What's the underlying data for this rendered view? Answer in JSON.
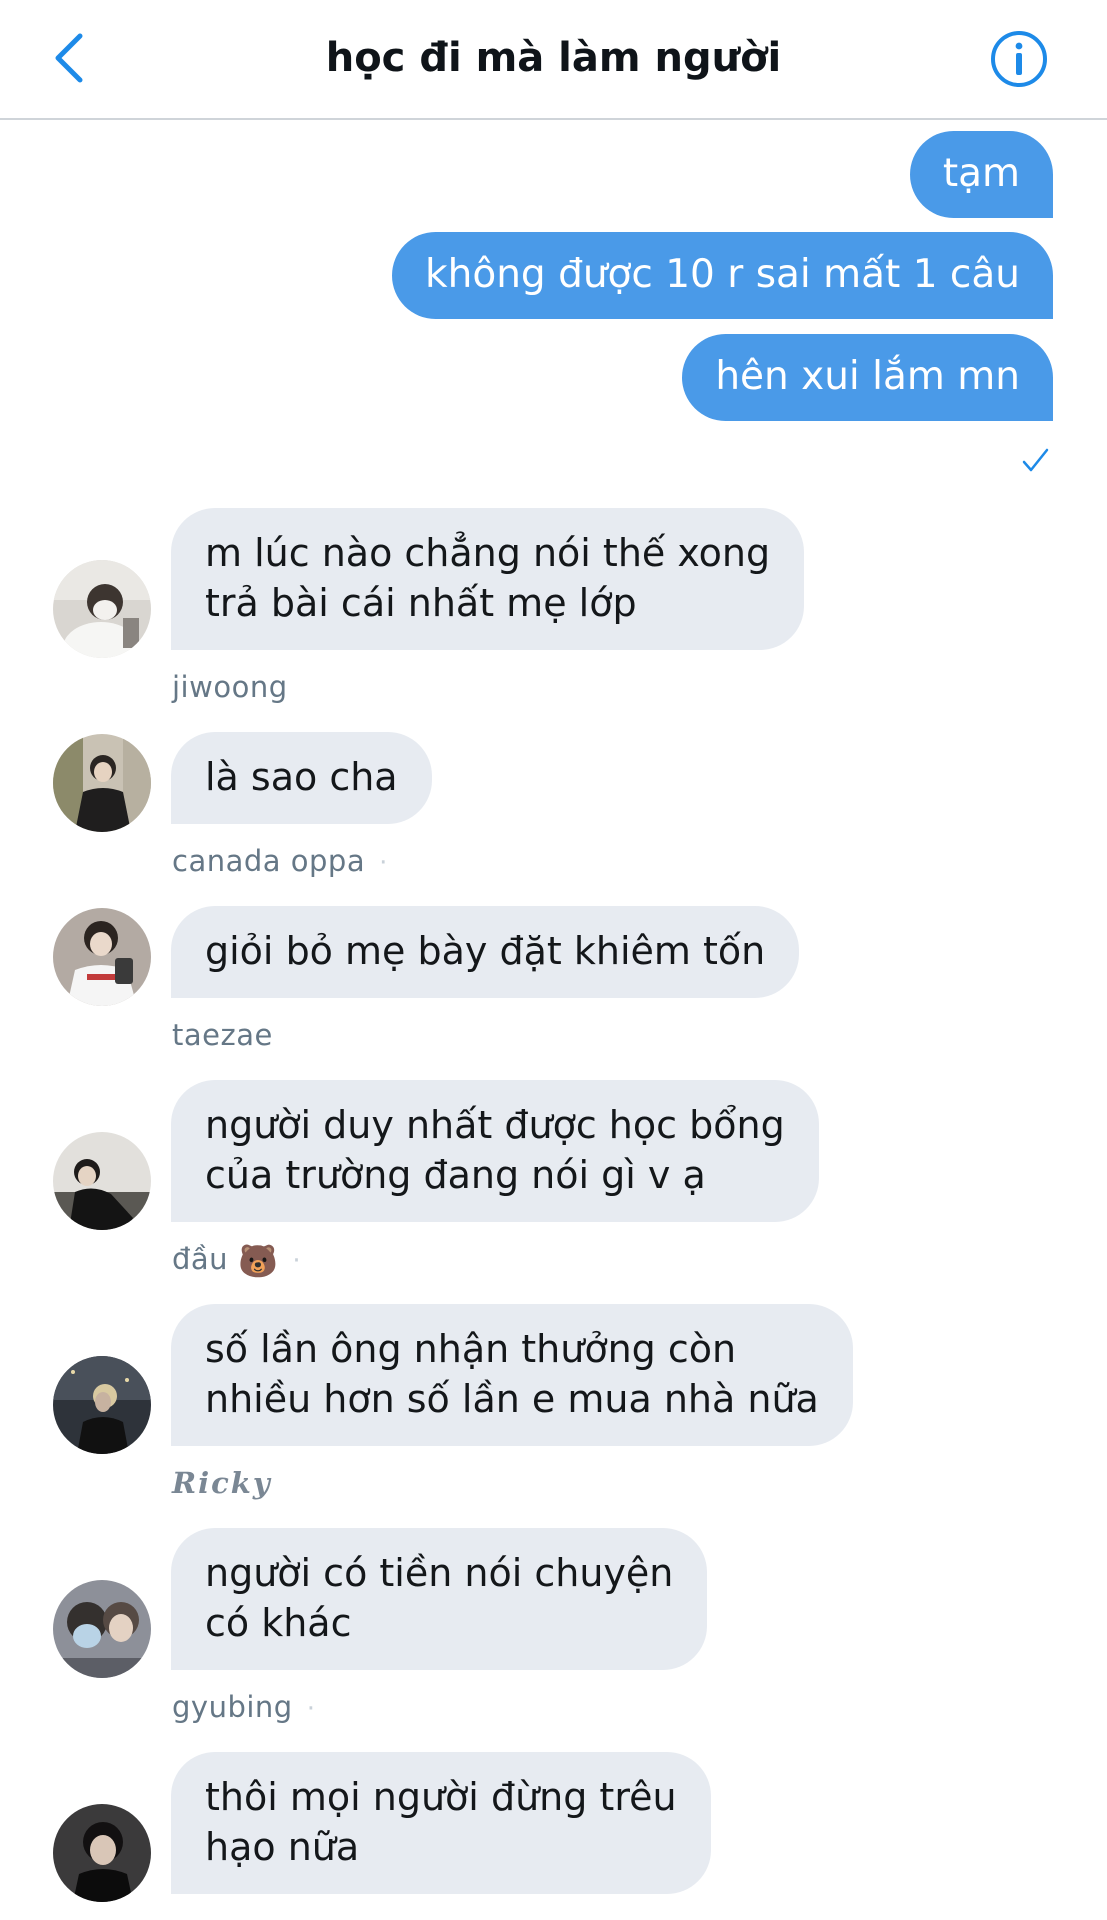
{
  "header": {
    "title": "học đi mà làm người",
    "back_icon": "chevron-left-icon",
    "info_icon": "info-circle-icon",
    "accent": "#1d8ae8"
  },
  "outgoing_messages": [
    {
      "text": "tạm"
    },
    {
      "text": "không được 10 r sai mất 1 câu"
    },
    {
      "text": "hên xui lắm mn"
    }
  ],
  "read_receipt_icon": "checkmark-icon",
  "incoming_messages": [
    {
      "text": "m lúc nào chẳng nói thế xong\ntrả bài cái nhất mẹ lớp",
      "sender": "jiwoong"
    },
    {
      "text": "là sao cha",
      "sender": "canada oppa"
    },
    {
      "text": "giỏi bỏ mẹ bày đặt khiêm tốn",
      "sender": "taezae"
    },
    {
      "text": "người duy nhất được học bổng\ncủa trường đang nói gì v ạ",
      "sender": "đầu",
      "sender_emoji": "🐻"
    },
    {
      "text": "số lần ông nhận thưởng còn\nnhiều hơn số lần e mua nhà nữa",
      "sender": "Ricky"
    },
    {
      "text": "người có tiền nói chuyện\ncó khác",
      "sender": "gyubing"
    },
    {
      "text": "thôi mọi người đừng trêu\nhạo nữa",
      "sender": ""
    }
  ],
  "colors": {
    "outgoing_bubble": "#4a9ae8",
    "incoming_bubble": "#e7ebf1",
    "sender_text": "#657786"
  }
}
